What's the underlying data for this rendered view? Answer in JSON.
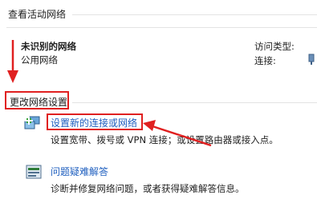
{
  "active_networks": {
    "heading": "查看活动网络",
    "network_name": "未识别的网络",
    "network_type": "公用网络",
    "access_type_label": "访问类型:",
    "connections_label": "连接:"
  },
  "change_settings": {
    "heading": "更改网络设置",
    "items": [
      {
        "link": "设置新的连接或网络",
        "description": "设置宽带、拨号或 VPN 连接；或设置路由器或接入点。",
        "icon": "network-setup-icon"
      },
      {
        "link": "问题疑难解答",
        "description": "诊断并修复网络问题，或者获得疑难解答信息。",
        "icon": "troubleshoot-icon"
      }
    ]
  },
  "annotation_color": "#e02020"
}
